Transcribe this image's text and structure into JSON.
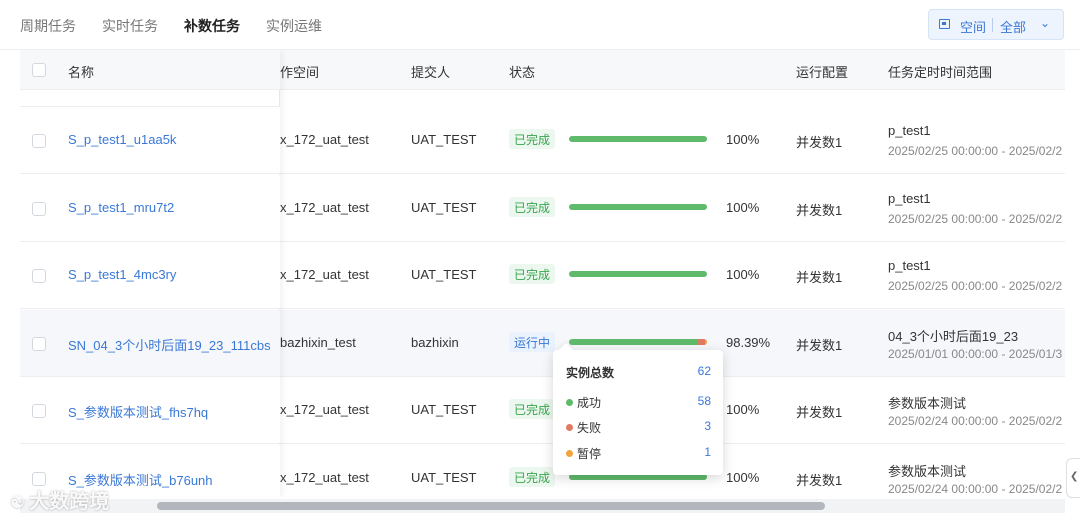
{
  "tabs": [
    "周期任务",
    "实时任务",
    "补数任务",
    "实例运维"
  ],
  "active_tab": "补数任务",
  "space_filter": {
    "label": "空间",
    "value": "全部"
  },
  "columns": {
    "name": "名称",
    "workspace": "作空间",
    "submitter": "提交人",
    "status": "状态",
    "run_config": "运行配置",
    "schedule_range": "任务定时时间范围"
  },
  "rows": [
    {
      "name": "S_p_test1_u1aa5k",
      "workspace": "x_172_uat_test",
      "submitter": "UAT_TEST",
      "status": "已完成",
      "progress": 100,
      "progress_text": "100%",
      "run_config": "并发数1",
      "task_title": "p_test1",
      "range": "2025/02/25 00:00:00 - 2025/02/2"
    },
    {
      "name": "S_p_test1_mru7t2",
      "workspace": "x_172_uat_test",
      "submitter": "UAT_TEST",
      "status": "已完成",
      "progress": 100,
      "progress_text": "100%",
      "run_config": "并发数1",
      "task_title": "p_test1",
      "range": "2025/02/25 00:00:00 - 2025/02/2"
    },
    {
      "name": "S_p_test1_4mc3ry",
      "workspace": "x_172_uat_test",
      "submitter": "UAT_TEST",
      "status": "已完成",
      "progress": 100,
      "progress_text": "100%",
      "run_config": "并发数1",
      "task_title": "p_test1",
      "range": "2025/02/25 00:00:00 - 2025/02/2"
    },
    {
      "name": "SN_04_3个小时后面19_23_111cbs",
      "workspace": "bazhixin_test",
      "submitter": "bazhixin",
      "status": "运行中",
      "progress": 98.39,
      "progress_text": "98.39%",
      "run_config": "并发数1",
      "task_title": "04_3个小时后面19_23",
      "range": "2025/01/01 00:00:00 - 2025/01/3"
    },
    {
      "name": "S_参数版本测试_fhs7hq",
      "workspace": "x_172_uat_test",
      "submitter": "UAT_TEST",
      "status": "已完成",
      "progress": 100,
      "progress_text": "100%",
      "run_config": "并发数1",
      "task_title": "参数版本测试",
      "range": "2025/02/24 00:00:00 - 2025/02/2"
    },
    {
      "name": "S_参数版本测试_b76unh",
      "workspace": "x_172_uat_test",
      "submitter": "UAT_TEST",
      "status": "已完成",
      "progress": 100,
      "progress_text": "100%",
      "run_config": "并发数1",
      "task_title": "参数版本测试",
      "range": "2025/02/24 00:00:00 - 2025/02/2"
    }
  ],
  "tooltip": {
    "title": "实例总数",
    "total": "62",
    "items": [
      {
        "label": "成功",
        "value": "58",
        "color": "#5fba6b"
      },
      {
        "label": "失败",
        "value": "3",
        "color": "#e07a62"
      },
      {
        "label": "暂停",
        "value": "1",
        "color": "#f2a43a"
      }
    ]
  },
  "watermark": "大数跨境"
}
